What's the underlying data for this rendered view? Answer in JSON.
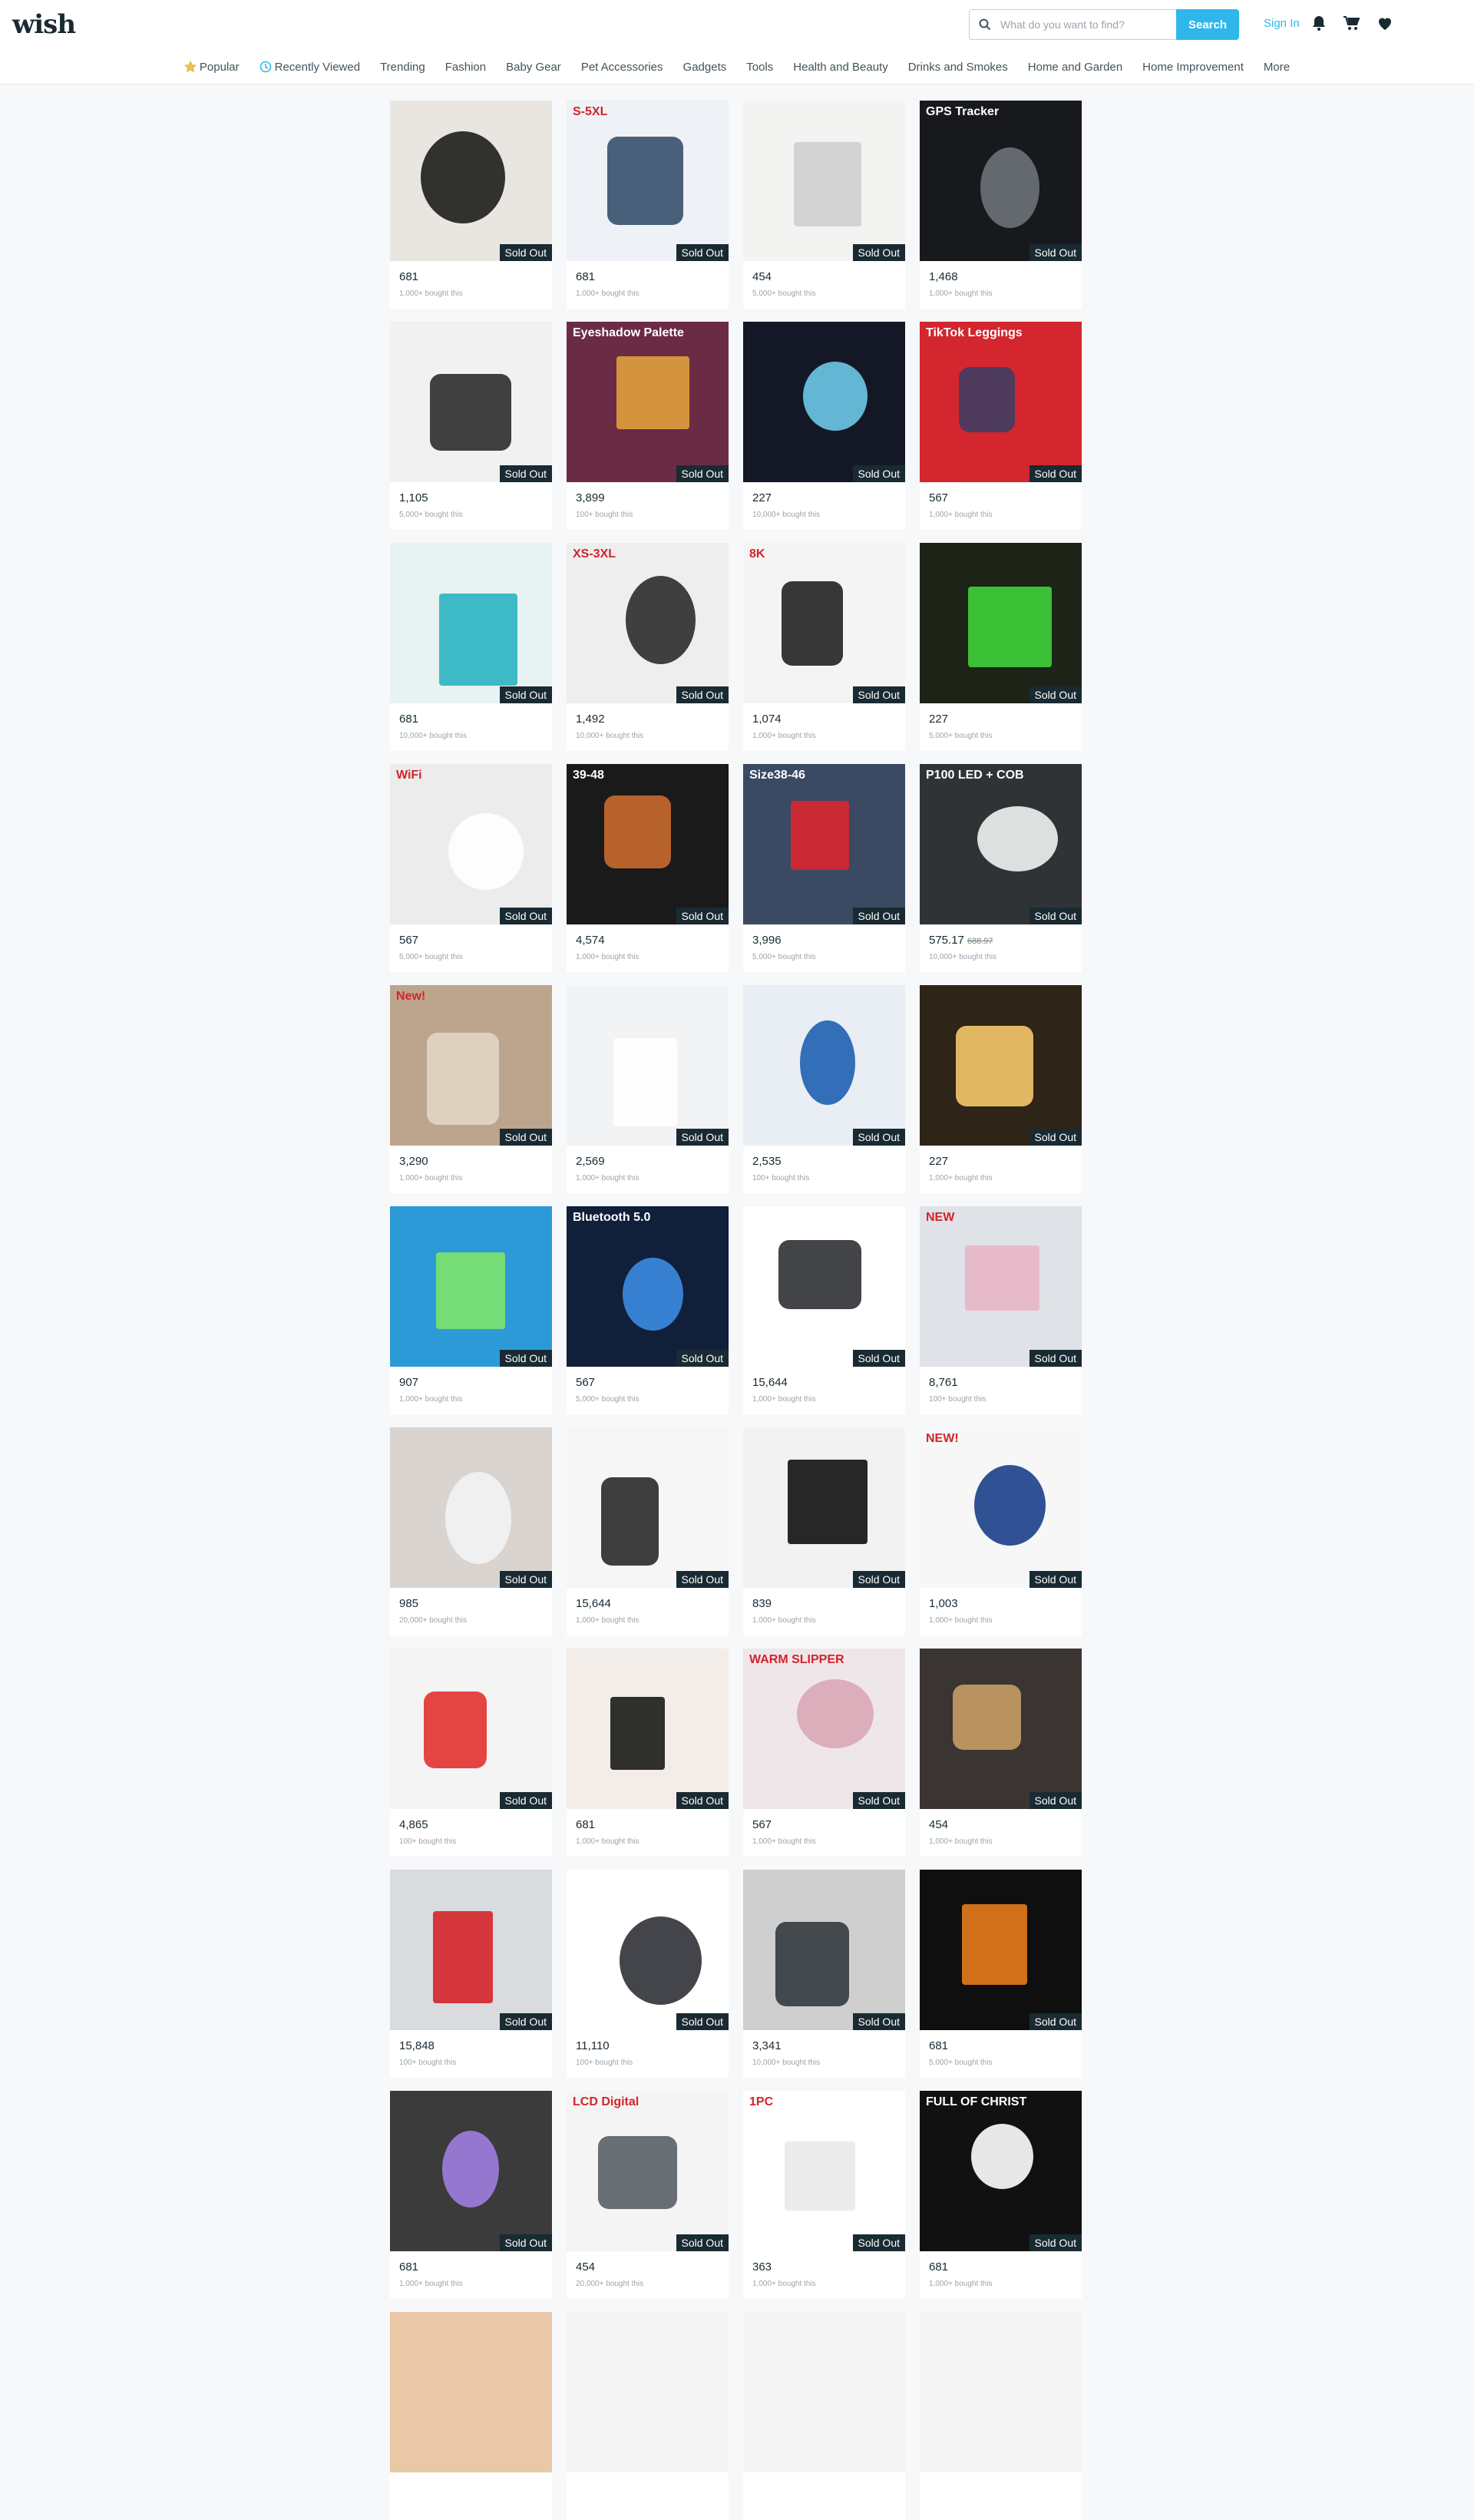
{
  "header": {
    "logo": "wish",
    "search_placeholder": "What do you want to find?",
    "search_button": "Search",
    "sign_in": "Sign In"
  },
  "nav": [
    "Popular",
    "Recently Viewed",
    "Trending",
    "Fashion",
    "Baby Gear",
    "Pet Accessories",
    "Gadgets",
    "Tools",
    "Health and Beauty",
    "Drinks and Smokes",
    "Home and Garden",
    "Home Improvement",
    "More"
  ],
  "sold_out_label": "Sold Out",
  "products": [
    {
      "price": "681",
      "bought": "1,000+ bought this",
      "bg": "#e9e6e1",
      "fg": "#1d1d1d"
    },
    {
      "price": "681",
      "bought": "1,000+ bought this",
      "bg": "#eef1f5",
      "fg": "#36506e",
      "caption": "S-5XL"
    },
    {
      "price": "454",
      "bought": "5,000+ bought this",
      "bg": "#f3f3f2",
      "fg": "#cfcfcf"
    },
    {
      "price": "1,468",
      "bought": "1,000+ bought this",
      "bg": "#17191c",
      "fg": "#6b7278",
      "caption": "GPS Tracker"
    },
    {
      "price": "1,105",
      "bought": "5,000+ bought this",
      "bg": "#f1f1f1",
      "fg": "#2c2c2c"
    },
    {
      "price": "3,899",
      "bought": "100+ bought this",
      "bg": "#6c2b45",
      "fg": "#e0a03d",
      "caption": "Eyeshadow Palette"
    },
    {
      "price": "227",
      "bought": "10,000+ bought this",
      "bg": "#141826",
      "fg": "#6bc9e8"
    },
    {
      "price": "567",
      "bought": "1,000+ bought this",
      "bg": "#d3262e",
      "fg": "#3f3d63",
      "caption": "TikTok Leggings"
    },
    {
      "price": "681",
      "bought": "10,000+ bought this",
      "bg": "#e7f2f2",
      "fg": "#2bb3c1"
    },
    {
      "price": "1,492",
      "bought": "10,000+ bought this",
      "bg": "#eeeeee",
      "fg": "#2b2b2b",
      "caption": "XS-3XL"
    },
    {
      "price": "1,074",
      "bought": "1,000+ bought this",
      "bg": "#f4f4f4",
      "fg": "#222222",
      "caption": "8K"
    },
    {
      "price": "227",
      "bought": "5,000+ bought this",
      "bg": "#1d2317",
      "fg": "#3fd13a"
    },
    {
      "price": "567",
      "bought": "5,000+ bought this",
      "bg": "#ececec",
      "fg": "#ffffff",
      "caption": "WiFi"
    },
    {
      "price": "4,574",
      "bought": "1,000+ bought this",
      "bg": "#1a1a1a",
      "fg": "#c96a2e",
      "caption": "39-48"
    },
    {
      "price": "3,996",
      "bought": "5,000+ bought this",
      "bg": "#3a4a62",
      "fg": "#d8262e",
      "caption": "Size38-46"
    },
    {
      "price": "575.17",
      "old_price": "688.97",
      "bought": "10,000+ bought this",
      "bg": "#303336",
      "fg": "#f2f2f2",
      "caption": "P100 LED + COB"
    },
    {
      "price": "3,290",
      "bought": "1,000+ bought this",
      "bg": "#bca58c",
      "fg": "#e2d6c4",
      "caption": "New!"
    },
    {
      "price": "2,569",
      "bought": "1,000+ bought this",
      "bg": "#f2f3f5",
      "fg": "#ffffff"
    },
    {
      "price": "2,535",
      "bought": "100+ bought this",
      "bg": "#e9eef4",
      "fg": "#1f5fb3"
    },
    {
      "price": "227",
      "bought": "1,000+ bought this",
      "bg": "#2e2418",
      "fg": "#f6c86a"
    },
    {
      "price": "907",
      "bought": "1,000+ bought this",
      "bg": "#2d9ad8",
      "fg": "#7ee36a"
    },
    {
      "price": "567",
      "bought": "5,000+ bought this",
      "bg": "#101f3a",
      "fg": "#3c8be2",
      "caption": "Bluetooth 5.0"
    },
    {
      "price": "15,644",
      "bought": "1,000+ bought this",
      "bg": "#ffffff",
      "fg": "#2e3034"
    },
    {
      "price": "8,761",
      "bought": "100+ bought this",
      "bg": "#dfe2e6",
      "fg": "#e8b6c5",
      "caption": "NEW"
    },
    {
      "price": "985",
      "bought": "20,000+ bought this",
      "bg": "#d9d4cf",
      "fg": "#f3f3f3"
    },
    {
      "price": "15,644",
      "bought": "1,000+ bought this",
      "bg": "#f6f6f6",
      "fg": "#2a2a2a"
    },
    {
      "price": "839",
      "bought": "1,000+ bought this",
      "bg": "#f2f2f2",
      "fg": "#111111"
    },
    {
      "price": "1,003",
      "bought": "1,000+ bought this",
      "bg": "#f7f7f7",
      "fg": "#1b3e8a",
      "caption": "NEW!"
    },
    {
      "price": "4,865",
      "bought": "100+ bought this",
      "bg": "#f4f4f4",
      "fg": "#e2322f"
    },
    {
      "price": "681",
      "bought": "1,000+ bought this",
      "bg": "#f2ede8",
      "fg": "#1a1a1a"
    },
    {
      "price": "567",
      "bought": "1,000+ bought this",
      "bg": "#efe6ea",
      "fg": "#d9a7b6",
      "caption": "WARM SLIPPER"
    },
    {
      "price": "454",
      "bought": "1,000+ bought this",
      "bg": "#3a3432",
      "fg": "#c69c64"
    },
    {
      "price": "15,848",
      "bought": "100+ bought this",
      "bg": "#d9dbde",
      "fg": "#d3232a"
    },
    {
      "price": "11,110",
      "bought": "100+ bought this",
      "bg": "#ffffff",
      "fg": "#2f3136"
    },
    {
      "price": "3,341",
      "bought": "10,000+ bought this",
      "bg": "#cfcfcf",
      "fg": "#33383e"
    },
    {
      "price": "681",
      "bought": "5,000+ bought this",
      "bg": "#0f0f0f",
      "fg": "#e87a1d"
    },
    {
      "price": "681",
      "bought": "1,000+ bought this",
      "bg": "#3b3b3b",
      "fg": "#a07ee0"
    },
    {
      "price": "454",
      "bought": "20,000+ bought this",
      "bg": "#f4f4f4",
      "fg": "#5a5f66",
      "caption": "LCD Digital"
    },
    {
      "price": "363",
      "bought": "1,000+ bought this",
      "bg": "#ffffff",
      "fg": "#e9e9e9",
      "caption": "1PC"
    },
    {
      "price": "681",
      "bought": "1,000+ bought this",
      "bg": "#111111",
      "fg": "#ffffff",
      "caption": "FULL OF CHRIST"
    }
  ],
  "partial_row": [
    {
      "bg": "#e9c8a8"
    },
    {
      "bg": "#f4f4f4"
    },
    {
      "bg": "#f4f4f4"
    },
    {
      "bg": "#f4f4f4"
    }
  ]
}
